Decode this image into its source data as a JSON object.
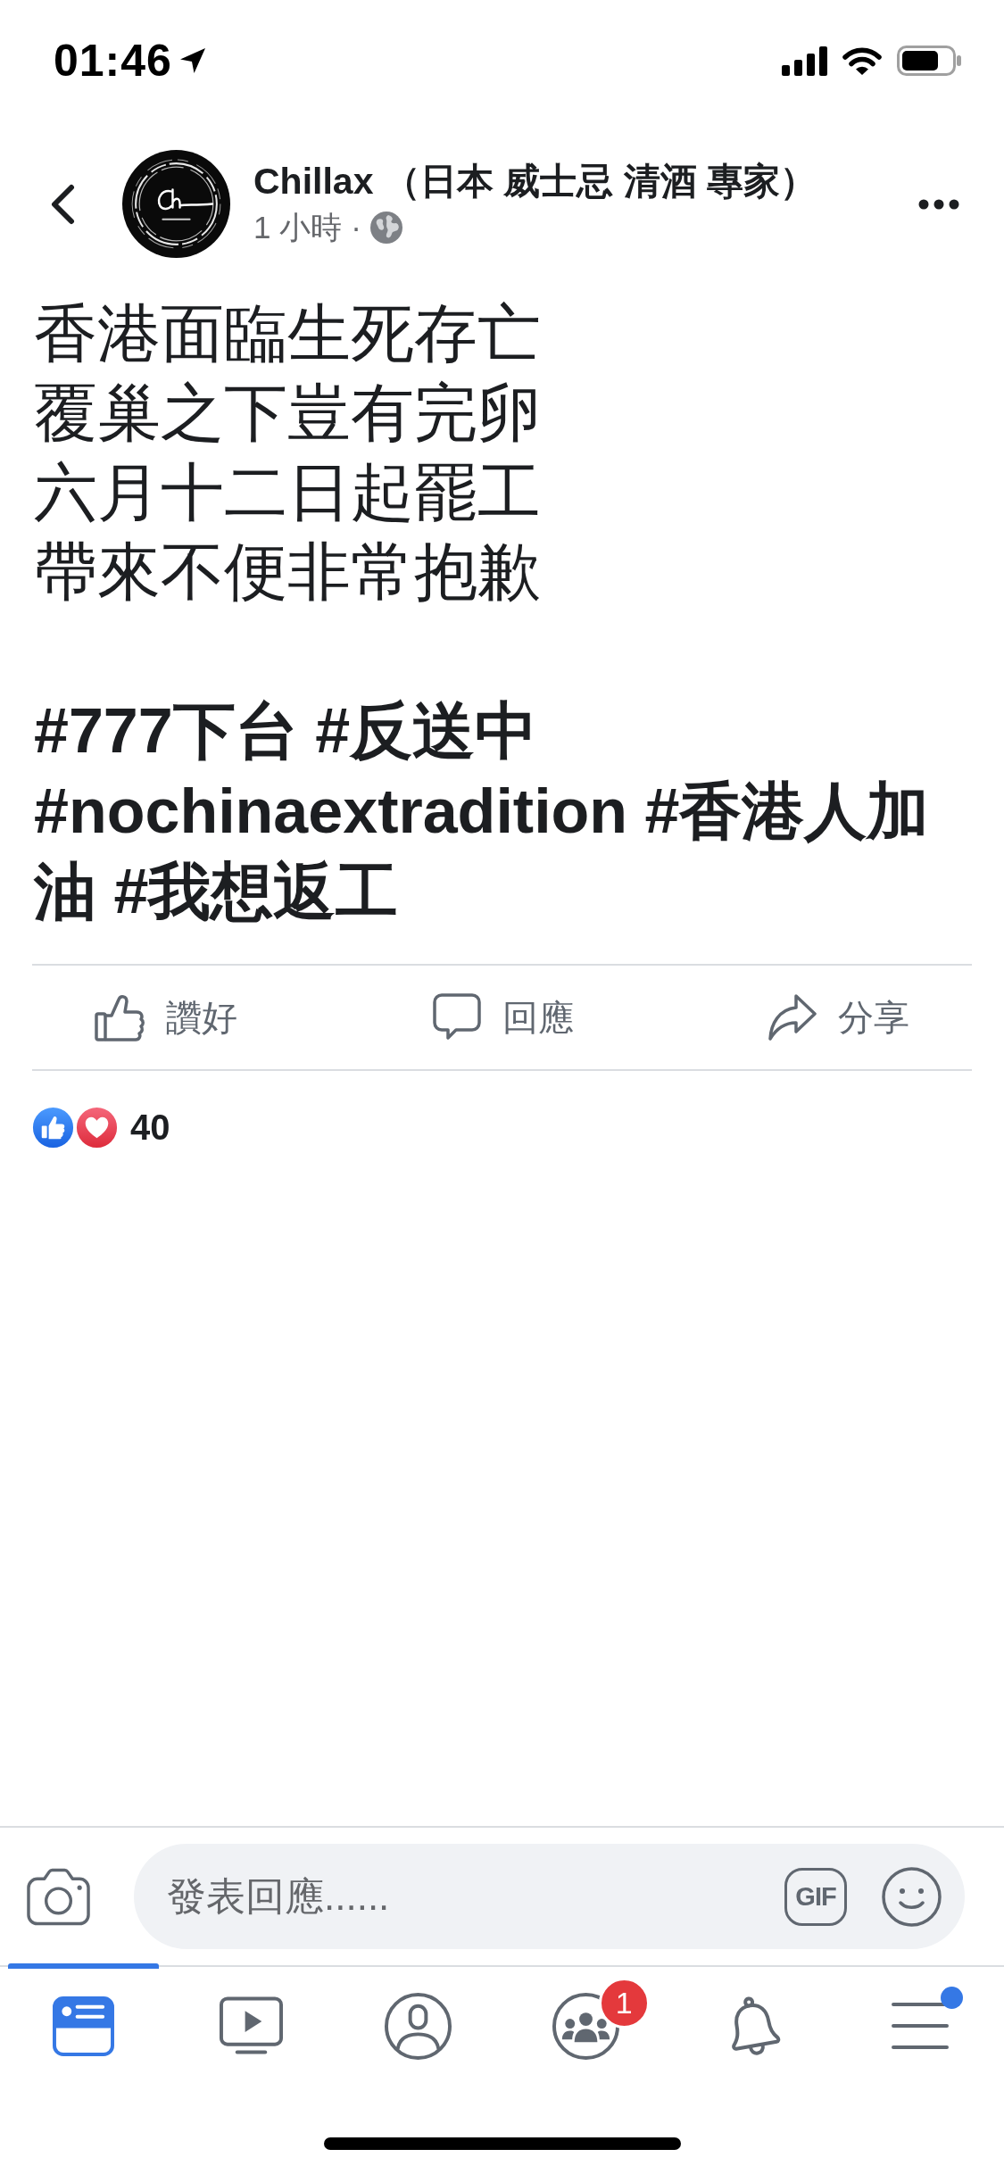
{
  "status_bar": {
    "time": "01:46"
  },
  "post_header": {
    "page_name": "Chillax （日本 威士忌 清酒 專家）",
    "time_ago": "1 小時",
    "separator": "·"
  },
  "post": {
    "body_lines": [
      "香港面臨生死存亡",
      "覆巢之下豈有完卵",
      "六月十二日起罷工",
      "帶來不便非常抱歉"
    ],
    "hashtag_lines": [
      "#777下台 #反送中",
      "#nochinaextradition #香港人加",
      "油 #我想返工"
    ]
  },
  "actions": [
    {
      "kind": "like",
      "label": "讚好"
    },
    {
      "kind": "comment",
      "label": "回應"
    },
    {
      "kind": "share",
      "label": "分享"
    }
  ],
  "reactions": {
    "types": [
      {
        "kind": "like"
      },
      {
        "kind": "love"
      }
    ],
    "count": "40"
  },
  "composer": {
    "placeholder": "發表回應......",
    "gif_label": "GIF"
  },
  "tab_bar": [
    {
      "kind": "feed",
      "selected": true,
      "dot": false
    },
    {
      "kind": "video",
      "selected": false,
      "dot": false
    },
    {
      "kind": "profile",
      "selected": false,
      "dot": false
    },
    {
      "kind": "groups",
      "selected": false,
      "dot": false,
      "badge": "1"
    },
    {
      "kind": "notifications",
      "selected": false,
      "dot": false
    },
    {
      "kind": "menu",
      "selected": false,
      "dot": true
    }
  ]
}
